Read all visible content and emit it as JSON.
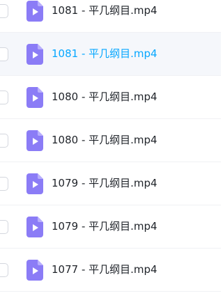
{
  "files": [
    {
      "name": "1081 - 平几纲目.mp4",
      "icon": "video-file-icon",
      "hovered": false
    },
    {
      "name": "1081 - 平几纲目.mp4",
      "icon": "video-file-icon",
      "hovered": true
    },
    {
      "name": "1080 - 平几纲目.mp4",
      "icon": "video-file-icon",
      "hovered": false
    },
    {
      "name": "1080 - 平几纲目.mp4",
      "icon": "video-file-icon",
      "hovered": false
    },
    {
      "name": "1079 - 平几纲目.mp4",
      "icon": "video-file-icon",
      "hovered": false
    },
    {
      "name": "1079 - 平几纲目.mp4",
      "icon": "video-file-icon",
      "hovered": false
    },
    {
      "name": "1077 - 平几纲目.mp4",
      "icon": "video-file-icon",
      "hovered": false
    }
  ],
  "colors": {
    "icon": "#8b7cf6",
    "link_hover": "#06a7ff",
    "text": "#1f2329"
  }
}
